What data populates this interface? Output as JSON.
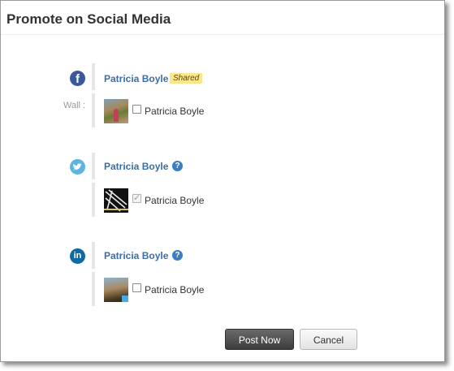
{
  "dialog": {
    "title": "Promote on Social Media"
  },
  "facebook": {
    "icon": "facebook-icon",
    "glyph": "f",
    "account_name": "Patricia Boyle",
    "badge": "Shared",
    "wall_label": "Wall :",
    "option_label": "Patricia Boyle",
    "checked": false
  },
  "twitter": {
    "icon": "twitter-icon",
    "account_name": "Patricia Boyle",
    "help_glyph": "?",
    "option_label": "Patricia Boyle",
    "checked": true
  },
  "linkedin": {
    "icon": "linkedin-icon",
    "glyph": "in",
    "account_name": "Patricia Boyle",
    "help_glyph": "?",
    "option_label": "Patricia Boyle",
    "checked": false
  },
  "buttons": {
    "post_now": "Post Now",
    "cancel": "Cancel"
  },
  "colors": {
    "facebook": "#3b5998",
    "twitter": "#5bb5e0",
    "linkedin": "#0e6aa2",
    "link": "#3b6ea8",
    "badge": "#fce68a"
  }
}
